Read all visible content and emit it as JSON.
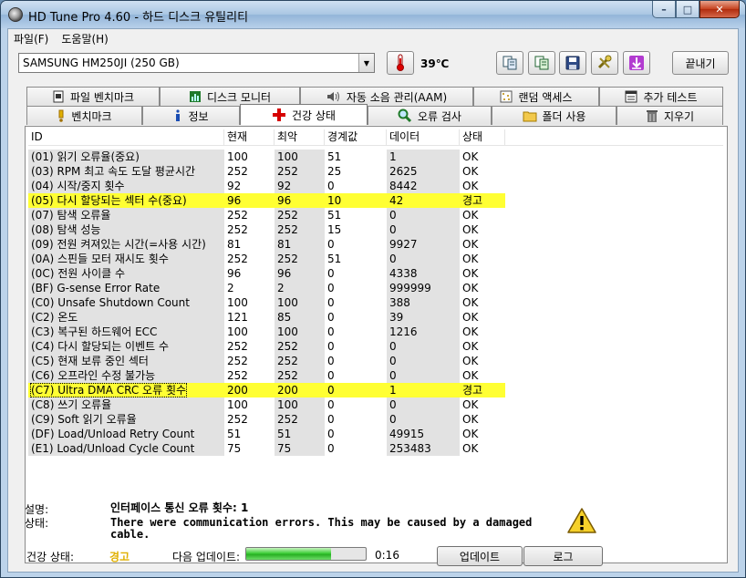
{
  "window": {
    "title": "HD Tune Pro 4.60 - 하드 디스크 유틸리티",
    "minimize": "–",
    "maximize": "□",
    "close": "✕"
  },
  "menu": [
    "파일(F)",
    "도움말(H)"
  ],
  "toolbar": {
    "drive": "SAMSUNG HM250JI (250 GB)",
    "temperature": "39℃",
    "exit_label": "끝내기"
  },
  "tabs_top": [
    {
      "label": "파일 벤치마크",
      "icon": "file-benchmark-icon"
    },
    {
      "label": "디스크 모니터",
      "icon": "disk-monitor-icon"
    },
    {
      "label": "자동 소음 관리(AAM)",
      "icon": "speaker-icon"
    },
    {
      "label": "랜덤 액세스",
      "icon": "random-access-icon"
    },
    {
      "label": "추가 테스트",
      "icon": "extra-tests-icon"
    }
  ],
  "tabs_bottom": [
    {
      "label": "벤치마크",
      "icon": "benchmark-icon"
    },
    {
      "label": "정보",
      "icon": "info-icon"
    },
    {
      "label": "건강 상태",
      "icon": "health-icon",
      "active": true
    },
    {
      "label": "오류 검사",
      "icon": "error-scan-icon"
    },
    {
      "label": "폴더 사용",
      "icon": "folder-usage-icon"
    },
    {
      "label": "지우기",
      "icon": "erase-icon"
    }
  ],
  "table": {
    "headers": [
      "ID",
      "현재",
      "최악",
      "경계값",
      "데이터",
      "상태"
    ],
    "rows": [
      {
        "id": "(01) 읽기 오류율(중요)",
        "cur": "100",
        "worst": "100",
        "th": "51",
        "data": "1",
        "st": "OK"
      },
      {
        "id": "(03) RPM 최고 속도 도달 평균시간",
        "cur": "252",
        "worst": "252",
        "th": "25",
        "data": "2625",
        "st": "OK"
      },
      {
        "id": "(04) 시작/중지 횟수",
        "cur": "92",
        "worst": "92",
        "th": "0",
        "data": "8442",
        "st": "OK"
      },
      {
        "id": "(05) 다시 할당되는 섹터 수(중요)",
        "cur": "96",
        "worst": "96",
        "th": "10",
        "data": "42",
        "st": "경고",
        "warn": true
      },
      {
        "id": "(07) 탐색 오류율",
        "cur": "252",
        "worst": "252",
        "th": "51",
        "data": "0",
        "st": "OK"
      },
      {
        "id": "(08) 탐색 성능",
        "cur": "252",
        "worst": "252",
        "th": "15",
        "data": "0",
        "st": "OK"
      },
      {
        "id": "(09) 전원 켜져있는 시간(=사용 시간)",
        "cur": "81",
        "worst": "81",
        "th": "0",
        "data": "9927",
        "st": "OK"
      },
      {
        "id": "(0A) 스핀들 모터 재시도 횟수",
        "cur": "252",
        "worst": "252",
        "th": "51",
        "data": "0",
        "st": "OK"
      },
      {
        "id": "(0C) 전원 사이클 수",
        "cur": "96",
        "worst": "96",
        "th": "0",
        "data": "4338",
        "st": "OK"
      },
      {
        "id": "(BF) G-sense Error Rate",
        "cur": "2",
        "worst": "2",
        "th": "0",
        "data": "999999",
        "st": "OK"
      },
      {
        "id": "(C0) Unsafe Shutdown Count",
        "cur": "100",
        "worst": "100",
        "th": "0",
        "data": "388",
        "st": "OK"
      },
      {
        "id": "(C2) 온도",
        "cur": "121",
        "worst": "85",
        "th": "0",
        "data": "39",
        "st": "OK"
      },
      {
        "id": "(C3) 복구된 하드웨어 ECC",
        "cur": "100",
        "worst": "100",
        "th": "0",
        "data": "1216",
        "st": "OK"
      },
      {
        "id": "(C4) 다시 할당되는 이벤트 수",
        "cur": "252",
        "worst": "252",
        "th": "0",
        "data": "0",
        "st": "OK"
      },
      {
        "id": "(C5) 현재 보류 중인 섹터",
        "cur": "252",
        "worst": "252",
        "th": "0",
        "data": "0",
        "st": "OK"
      },
      {
        "id": "(C6) 오프라인 수정 불가능",
        "cur": "252",
        "worst": "252",
        "th": "0",
        "data": "0",
        "st": "OK"
      },
      {
        "id": "(C7) Ultra DMA CRC 오류 횟수",
        "cur": "200",
        "worst": "200",
        "th": "0",
        "data": "1",
        "st": "경고",
        "warn": true,
        "focus": true
      },
      {
        "id": "(C8) 쓰기 오류율",
        "cur": "100",
        "worst": "100",
        "th": "0",
        "data": "0",
        "st": "OK"
      },
      {
        "id": "(C9) Soft 읽기 오류율",
        "cur": "252",
        "worst": "252",
        "th": "0",
        "data": "0",
        "st": "OK"
      },
      {
        "id": "(DF) Load/Unload Retry Count",
        "cur": "51",
        "worst": "51",
        "th": "0",
        "data": "49915",
        "st": "OK"
      },
      {
        "id": "(E1) Load/Unload Cycle Count",
        "cur": "75",
        "worst": "75",
        "th": "0",
        "data": "253483",
        "st": "OK"
      }
    ]
  },
  "details": {
    "desc_label": "설명:",
    "desc_value": "인터페이스 통신 오류 횟수: 1",
    "status_label": "상태:",
    "status_line1": "There were communication errors. This may be caused by a damaged",
    "status_line2": "cable."
  },
  "footer": {
    "health_label": "건강 상태:",
    "health_value": "경고",
    "health_color": "#e0b000",
    "next_update_label": "다음 업데이트:",
    "progress": 0.71,
    "countdown": "0:16",
    "update_button": "업데이트",
    "log_button": "로그"
  }
}
